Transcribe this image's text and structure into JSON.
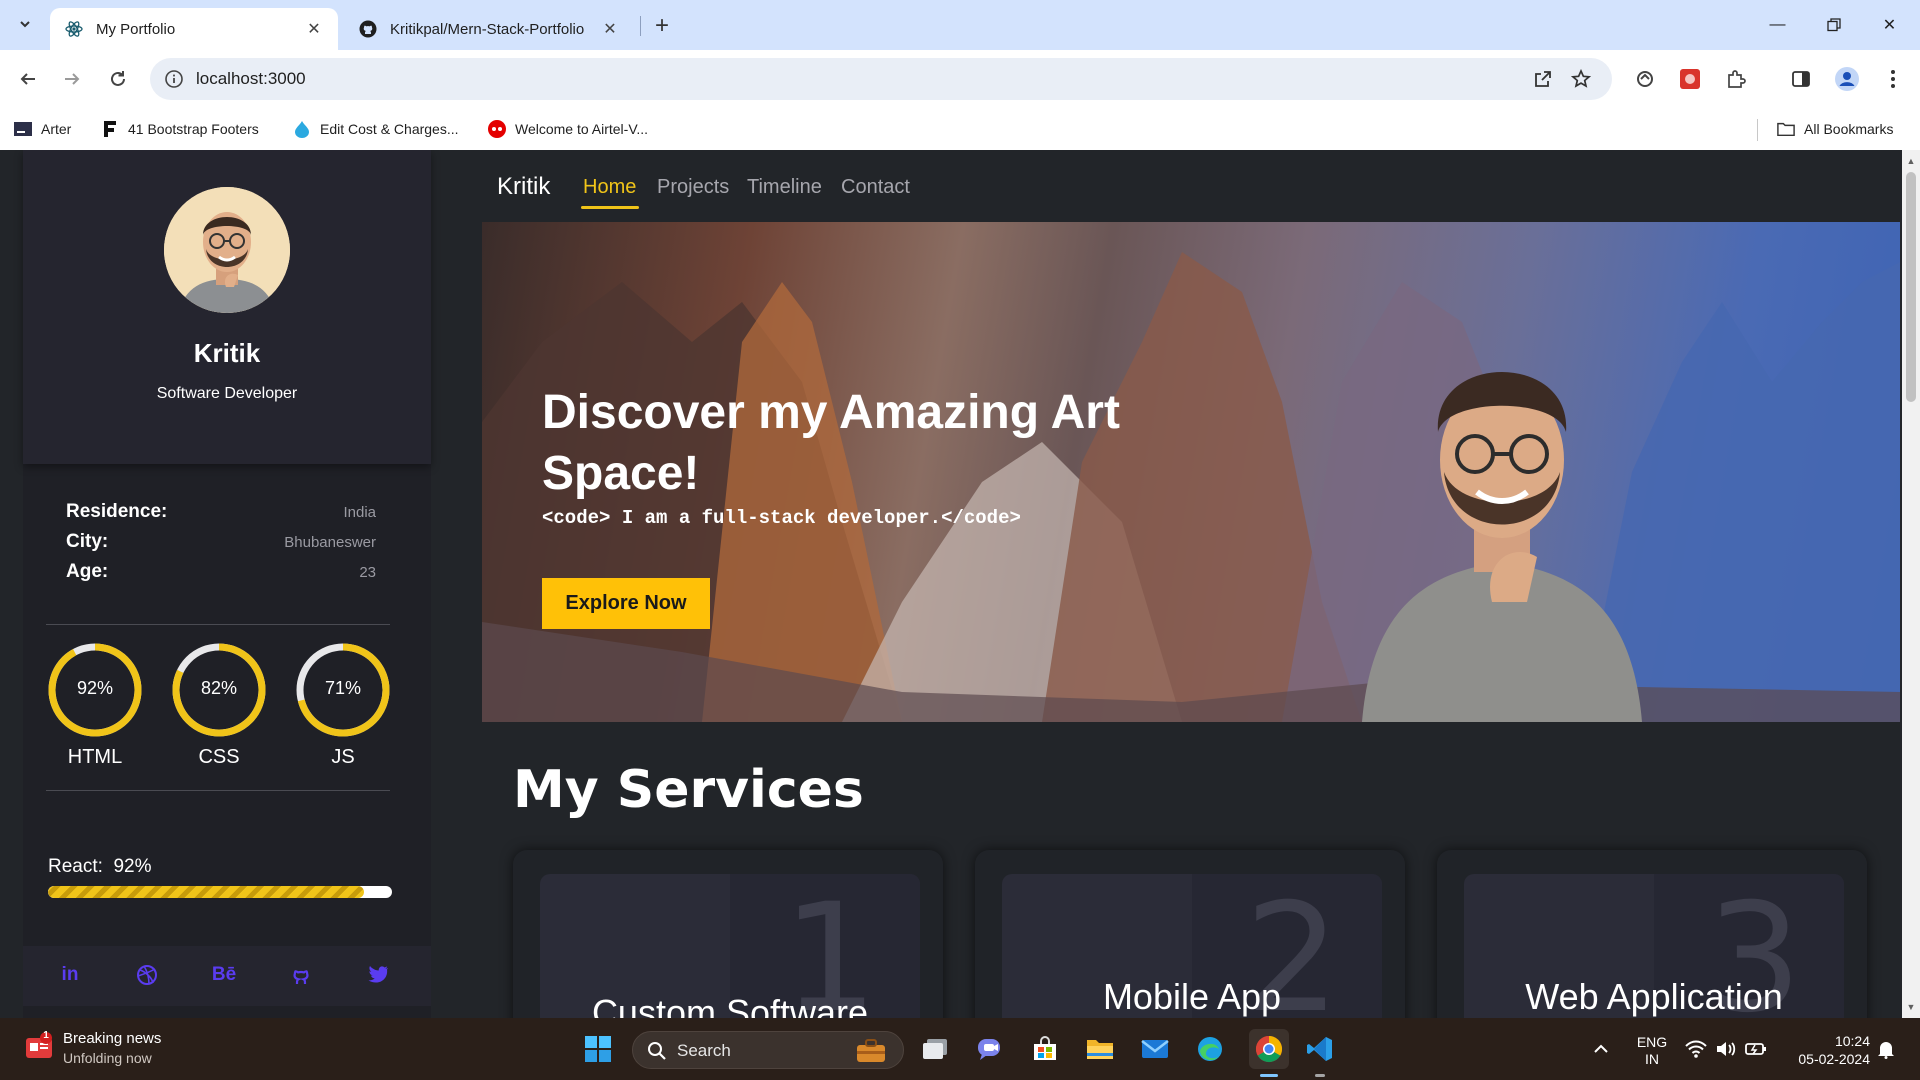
{
  "browser": {
    "tabs": [
      {
        "title": "My Portfolio",
        "active": true
      },
      {
        "title": "Kritikpal/Mern-Stack-Portfolio",
        "active": false
      }
    ],
    "url": "localhost:3000",
    "bookmarks": [
      {
        "label": "Arter"
      },
      {
        "label": "41 Bootstrap Footers"
      },
      {
        "label": "Edit Cost & Charges..."
      },
      {
        "label": "Welcome to Airtel-V..."
      }
    ],
    "all_bookmarks": "All Bookmarks"
  },
  "sidebar": {
    "name": "Kritik",
    "role": "Software Developer",
    "info": [
      {
        "key": "Residence:",
        "value": "India"
      },
      {
        "key": "City:",
        "value": "Bhubaneswer"
      },
      {
        "key": "Age:",
        "value": "23"
      }
    ],
    "skills": [
      {
        "label": "HTML",
        "percent_text": "92%",
        "value": 0.92
      },
      {
        "label": "CSS",
        "percent_text": "82%",
        "value": 0.82
      },
      {
        "label": "JS",
        "percent_text": "71%",
        "value": 0.71
      }
    ],
    "react": {
      "label": "React:",
      "percent_text": "92%",
      "value": 0.92
    },
    "socials": [
      "linkedin-icon",
      "dribbble-icon",
      "behance-icon",
      "github-icon",
      "twitter-icon"
    ],
    "social_texts": {
      "linkedin": "in",
      "behance": "Bē"
    }
  },
  "nav": {
    "brand": "Kritik",
    "links": [
      "Home",
      "Projects",
      "Timeline",
      "Contact"
    ],
    "active": "Home"
  },
  "hero": {
    "title": "Discover my Amazing Art Space!",
    "code": "<code> I am a full-stack developer.</code>",
    "button": "Explore Now"
  },
  "services": {
    "title": "My Services",
    "cards": [
      {
        "num": "1",
        "name": "Custom Software"
      },
      {
        "num": "2",
        "name": "Mobile App"
      },
      {
        "num": "3",
        "name": "Web Application"
      }
    ]
  },
  "taskbar": {
    "news_title": "Breaking news",
    "news_sub": "Unfolding now",
    "news_badge": "1",
    "search": "Search",
    "lang1": "ENG",
    "lang2": "IN",
    "time": "10:24",
    "date": "05-02-2024"
  },
  "colors": {
    "accent": "#f0c419",
    "button": "#ffc107",
    "social": "#5a3cf0",
    "page_bg": "#222529"
  }
}
